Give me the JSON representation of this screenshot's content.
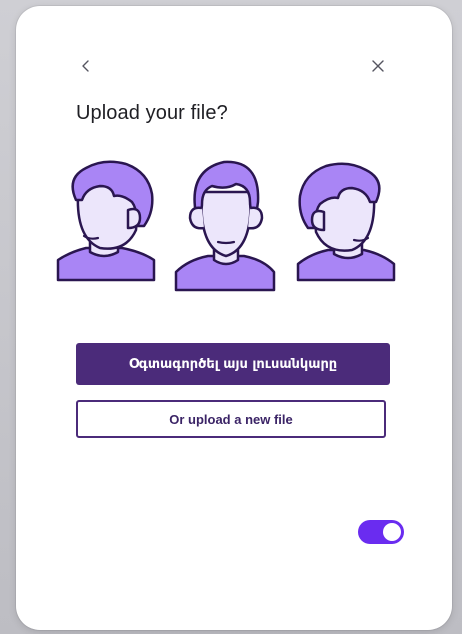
{
  "dialog": {
    "title": "Upload your file?",
    "primary_button_label": "Օգտագործել այս լուսանկարը",
    "secondary_button_label": "Or upload a new file",
    "toggle_on": true
  },
  "icons": {
    "back": "chevron-left-icon",
    "close": "close-icon",
    "illustration": [
      "head-left-profile",
      "head-front",
      "head-right-profile"
    ]
  },
  "colors": {
    "primary": "#4b2b7a",
    "accent": "#6a2cf0",
    "hair": "#a985f5",
    "face": "#ece6fb",
    "outline": "#2a1650"
  }
}
